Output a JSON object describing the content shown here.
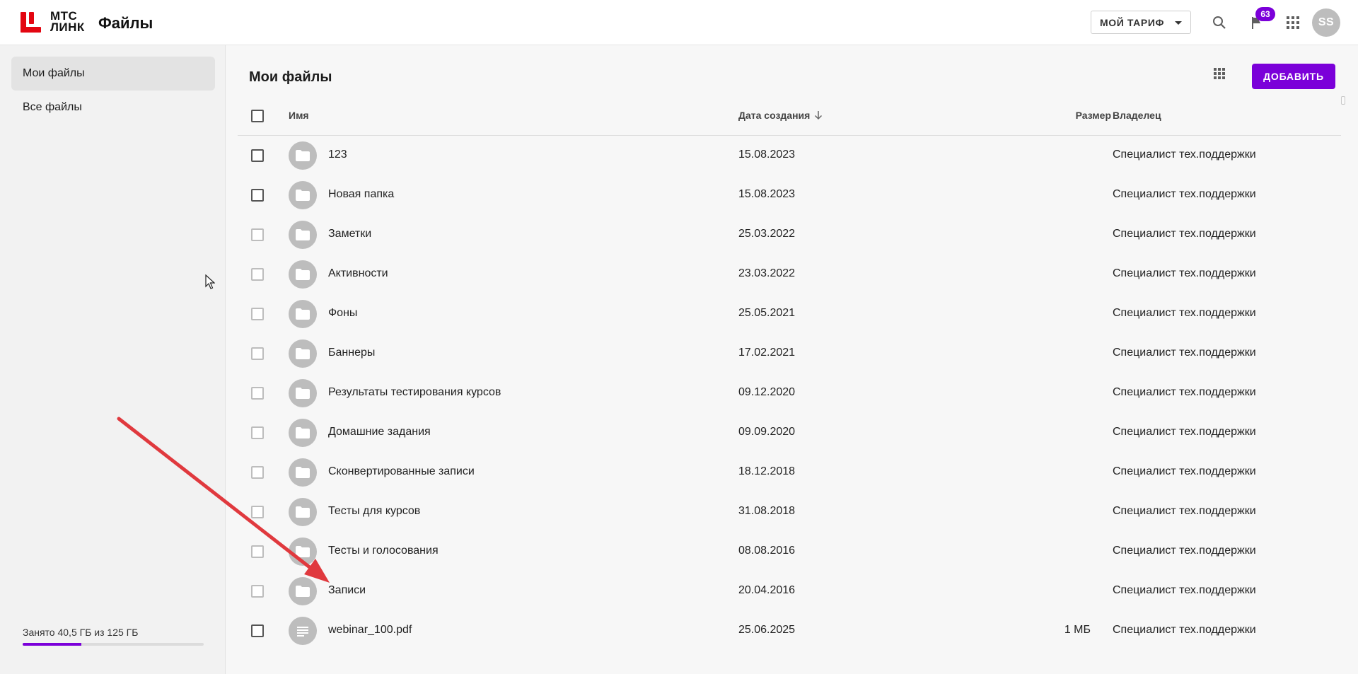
{
  "header": {
    "brand_line1": "МТС",
    "brand_line2": "ЛИНК",
    "app_title": "Файлы",
    "tariff_label": "МОЙ ТАРИФ",
    "notifications_count": "63",
    "avatar_initials": "SS",
    "icons": [
      "search-icon",
      "flag-icon",
      "apps-grid-icon"
    ]
  },
  "sidebar": {
    "items": [
      {
        "label": "Мои файлы",
        "active": true
      },
      {
        "label": "Все файлы",
        "active": false
      }
    ],
    "storage": {
      "label": "Занято 40,5 ГБ из 125 ГБ",
      "used_fraction": 0.324
    }
  },
  "main": {
    "title": "Мои файлы",
    "add_button": "ДОБАВИТЬ",
    "columns": {
      "name": "Имя",
      "date": "Дата создания",
      "size": "Размер",
      "owner": "Владелец"
    },
    "rows": [
      {
        "type": "folder",
        "name": "123",
        "date": "15.08.2023",
        "size": "",
        "owner": "Специалист тех.поддержки"
      },
      {
        "type": "folder",
        "name": "Новая папка",
        "date": "15.08.2023",
        "size": "",
        "owner": "Специалист тех.поддержки"
      },
      {
        "type": "folder",
        "name": "Заметки",
        "date": "25.03.2022",
        "size": "",
        "owner": "Специалист тех.поддержки"
      },
      {
        "type": "folder",
        "name": "Активности",
        "date": "23.03.2022",
        "size": "",
        "owner": "Специалист тех.поддержки"
      },
      {
        "type": "folder",
        "name": "Фоны",
        "date": "25.05.2021",
        "size": "",
        "owner": "Специалист тех.поддержки"
      },
      {
        "type": "folder",
        "name": "Баннеры",
        "date": "17.02.2021",
        "size": "",
        "owner": "Специалист тех.поддержки"
      },
      {
        "type": "folder",
        "name": "Результаты тестирования курсов",
        "date": "09.12.2020",
        "size": "",
        "owner": "Специалист тех.поддержки"
      },
      {
        "type": "folder",
        "name": "Домашние задания",
        "date": "09.09.2020",
        "size": "",
        "owner": "Специалист тех.поддержки"
      },
      {
        "type": "folder",
        "name": "Сконвертированные записи",
        "date": "18.12.2018",
        "size": "",
        "owner": "Специалист тех.поддержки"
      },
      {
        "type": "folder",
        "name": "Тесты для курсов",
        "date": "31.08.2018",
        "size": "",
        "owner": "Специалист тех.поддержки"
      },
      {
        "type": "folder",
        "name": "Тесты и голосования",
        "date": "08.08.2016",
        "size": "",
        "owner": "Специалист тех.поддержки"
      },
      {
        "type": "folder",
        "name": "Записи",
        "date": "20.04.2016",
        "size": "",
        "owner": "Специалист тех.поддержки"
      },
      {
        "type": "file",
        "name": "webinar_100.pdf",
        "date": "25.06.2025",
        "size": "1 МБ",
        "owner": "Специалист тех.поддержки"
      }
    ]
  },
  "colors": {
    "accent": "#7b00d9",
    "logo_red": "#e30611",
    "annotation_arrow": "#e0393e"
  }
}
